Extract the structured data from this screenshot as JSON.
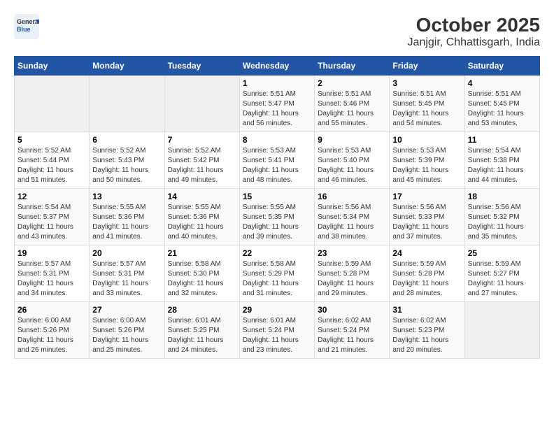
{
  "logo": {
    "general": "General",
    "blue": "Blue"
  },
  "title": "October 2025",
  "subtitle": "Janjgir, Chhattisgarh, India",
  "days_of_week": [
    "Sunday",
    "Monday",
    "Tuesday",
    "Wednesday",
    "Thursday",
    "Friday",
    "Saturday"
  ],
  "weeks": [
    [
      {
        "day": "",
        "info": ""
      },
      {
        "day": "",
        "info": ""
      },
      {
        "day": "",
        "info": ""
      },
      {
        "day": "1",
        "info": "Sunrise: 5:51 AM\nSunset: 5:47 PM\nDaylight: 11 hours and 56 minutes."
      },
      {
        "day": "2",
        "info": "Sunrise: 5:51 AM\nSunset: 5:46 PM\nDaylight: 11 hours and 55 minutes."
      },
      {
        "day": "3",
        "info": "Sunrise: 5:51 AM\nSunset: 5:45 PM\nDaylight: 11 hours and 54 minutes."
      },
      {
        "day": "4",
        "info": "Sunrise: 5:51 AM\nSunset: 5:45 PM\nDaylight: 11 hours and 53 minutes."
      }
    ],
    [
      {
        "day": "5",
        "info": "Sunrise: 5:52 AM\nSunset: 5:44 PM\nDaylight: 11 hours and 51 minutes."
      },
      {
        "day": "6",
        "info": "Sunrise: 5:52 AM\nSunset: 5:43 PM\nDaylight: 11 hours and 50 minutes."
      },
      {
        "day": "7",
        "info": "Sunrise: 5:52 AM\nSunset: 5:42 PM\nDaylight: 11 hours and 49 minutes."
      },
      {
        "day": "8",
        "info": "Sunrise: 5:53 AM\nSunset: 5:41 PM\nDaylight: 11 hours and 48 minutes."
      },
      {
        "day": "9",
        "info": "Sunrise: 5:53 AM\nSunset: 5:40 PM\nDaylight: 11 hours and 46 minutes."
      },
      {
        "day": "10",
        "info": "Sunrise: 5:53 AM\nSunset: 5:39 PM\nDaylight: 11 hours and 45 minutes."
      },
      {
        "day": "11",
        "info": "Sunrise: 5:54 AM\nSunset: 5:38 PM\nDaylight: 11 hours and 44 minutes."
      }
    ],
    [
      {
        "day": "12",
        "info": "Sunrise: 5:54 AM\nSunset: 5:37 PM\nDaylight: 11 hours and 43 minutes."
      },
      {
        "day": "13",
        "info": "Sunrise: 5:55 AM\nSunset: 5:36 PM\nDaylight: 11 hours and 41 minutes."
      },
      {
        "day": "14",
        "info": "Sunrise: 5:55 AM\nSunset: 5:36 PM\nDaylight: 11 hours and 40 minutes."
      },
      {
        "day": "15",
        "info": "Sunrise: 5:55 AM\nSunset: 5:35 PM\nDaylight: 11 hours and 39 minutes."
      },
      {
        "day": "16",
        "info": "Sunrise: 5:56 AM\nSunset: 5:34 PM\nDaylight: 11 hours and 38 minutes."
      },
      {
        "day": "17",
        "info": "Sunrise: 5:56 AM\nSunset: 5:33 PM\nDaylight: 11 hours and 37 minutes."
      },
      {
        "day": "18",
        "info": "Sunrise: 5:56 AM\nSunset: 5:32 PM\nDaylight: 11 hours and 35 minutes."
      }
    ],
    [
      {
        "day": "19",
        "info": "Sunrise: 5:57 AM\nSunset: 5:31 PM\nDaylight: 11 hours and 34 minutes."
      },
      {
        "day": "20",
        "info": "Sunrise: 5:57 AM\nSunset: 5:31 PM\nDaylight: 11 hours and 33 minutes."
      },
      {
        "day": "21",
        "info": "Sunrise: 5:58 AM\nSunset: 5:30 PM\nDaylight: 11 hours and 32 minutes."
      },
      {
        "day": "22",
        "info": "Sunrise: 5:58 AM\nSunset: 5:29 PM\nDaylight: 11 hours and 31 minutes."
      },
      {
        "day": "23",
        "info": "Sunrise: 5:59 AM\nSunset: 5:28 PM\nDaylight: 11 hours and 29 minutes."
      },
      {
        "day": "24",
        "info": "Sunrise: 5:59 AM\nSunset: 5:28 PM\nDaylight: 11 hours and 28 minutes."
      },
      {
        "day": "25",
        "info": "Sunrise: 5:59 AM\nSunset: 5:27 PM\nDaylight: 11 hours and 27 minutes."
      }
    ],
    [
      {
        "day": "26",
        "info": "Sunrise: 6:00 AM\nSunset: 5:26 PM\nDaylight: 11 hours and 26 minutes."
      },
      {
        "day": "27",
        "info": "Sunrise: 6:00 AM\nSunset: 5:26 PM\nDaylight: 11 hours and 25 minutes."
      },
      {
        "day": "28",
        "info": "Sunrise: 6:01 AM\nSunset: 5:25 PM\nDaylight: 11 hours and 24 minutes."
      },
      {
        "day": "29",
        "info": "Sunrise: 6:01 AM\nSunset: 5:24 PM\nDaylight: 11 hours and 23 minutes."
      },
      {
        "day": "30",
        "info": "Sunrise: 6:02 AM\nSunset: 5:24 PM\nDaylight: 11 hours and 21 minutes."
      },
      {
        "day": "31",
        "info": "Sunrise: 6:02 AM\nSunset: 5:23 PM\nDaylight: 11 hours and 20 minutes."
      },
      {
        "day": "",
        "info": ""
      }
    ]
  ]
}
